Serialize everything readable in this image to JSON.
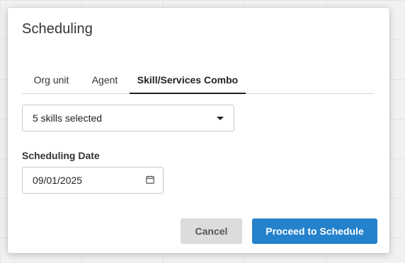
{
  "modal": {
    "title": "Scheduling"
  },
  "tabs": [
    {
      "label": "Org unit",
      "active": false
    },
    {
      "label": "Agent",
      "active": false
    },
    {
      "label": "Skill/Services Combo",
      "active": true
    }
  ],
  "skills_select": {
    "value": "5 skills selected",
    "icon": "caret-down-icon"
  },
  "scheduling_date": {
    "label": "Scheduling Date",
    "value": "09/01/2025",
    "icon": "calendar-icon"
  },
  "actions": {
    "cancel_label": "Cancel",
    "proceed_label": "Proceed to Schedule"
  },
  "colors": {
    "primary": "#2481cc",
    "secondary": "#dcdcdc",
    "active_tab_underline": "#222222"
  }
}
